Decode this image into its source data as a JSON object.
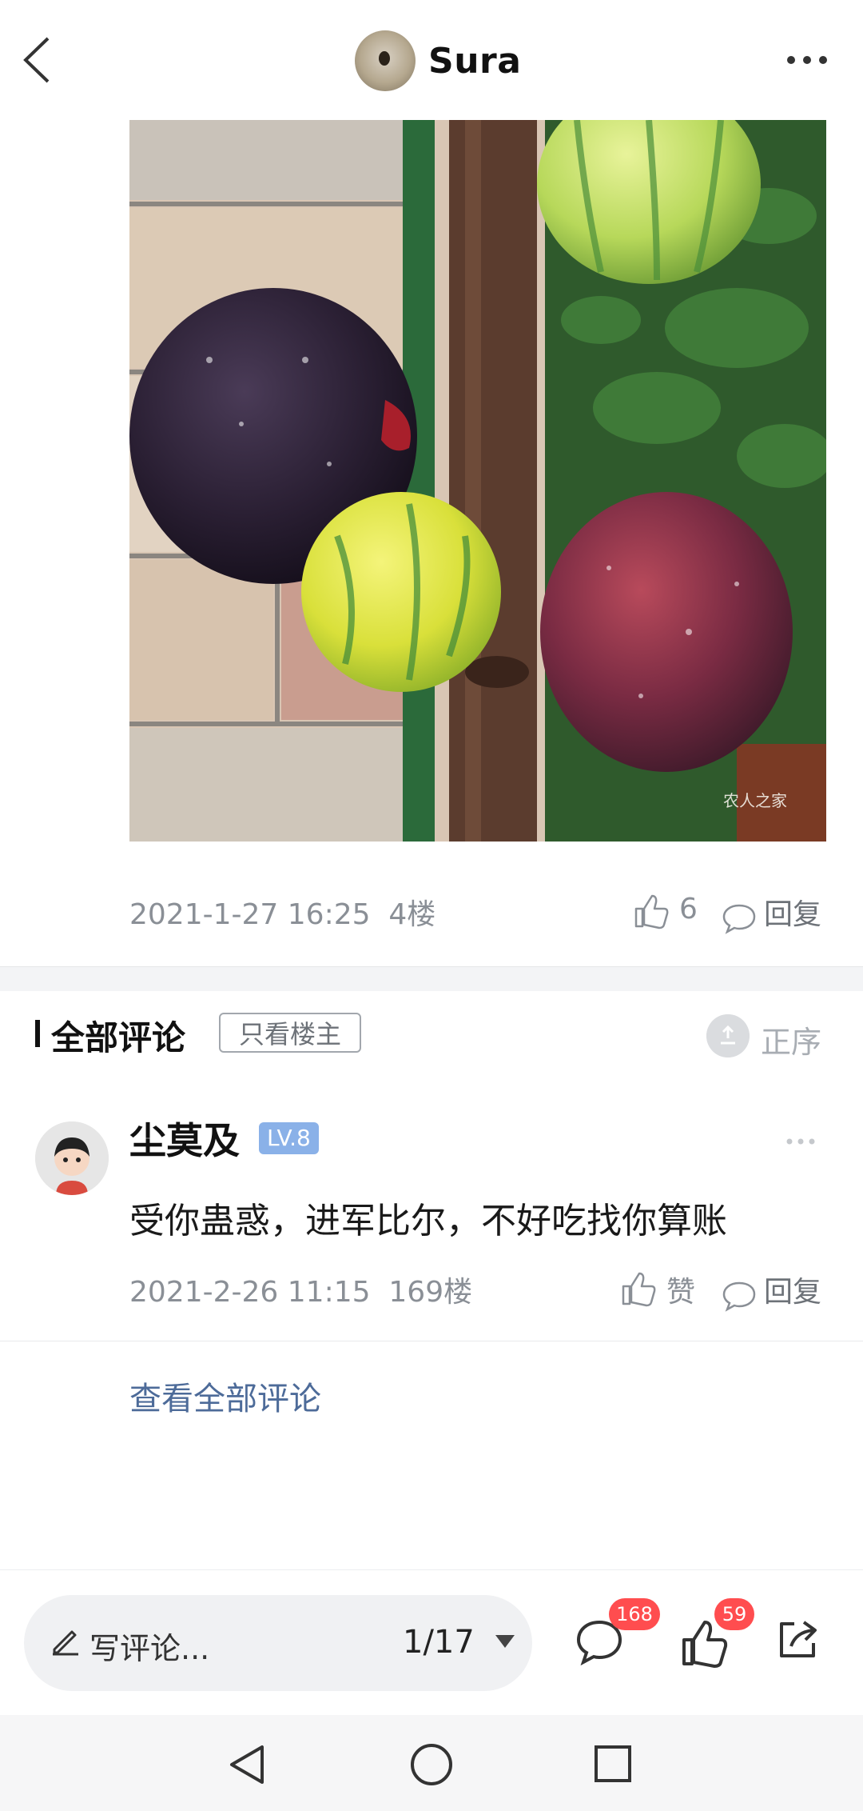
{
  "header": {
    "title": "Sura",
    "avatar_icon": "avatar-icon",
    "more_icon": "more-icon",
    "back_icon": "back-icon"
  },
  "post": {
    "image_watermark": "农人之家",
    "timestamp": "2021-1-27 16:25",
    "floor": "4楼",
    "like_count": "6",
    "reply_label": "回复"
  },
  "comments_section": {
    "title": "全部评论",
    "only_op_label": "只看楼主",
    "sort_label": "正序"
  },
  "comment": {
    "author": "尘莫及",
    "level": "LV.8",
    "text": "受你蛊惑，进军比尔，不好吃找你算账",
    "timestamp": "2021-2-26 11:15",
    "floor": "169楼",
    "like_label": "赞",
    "reply_label": "回复"
  },
  "view_all_label": "查看全部评论",
  "bottom_bar": {
    "write_placeholder": "写评论...",
    "page_indicator": "1/17",
    "comment_badge": "168",
    "like_badge": "59"
  },
  "colors": {
    "accent_link": "#4d6b99",
    "badge": "#ff4d4f",
    "level_badge": "#8ab1e8"
  }
}
